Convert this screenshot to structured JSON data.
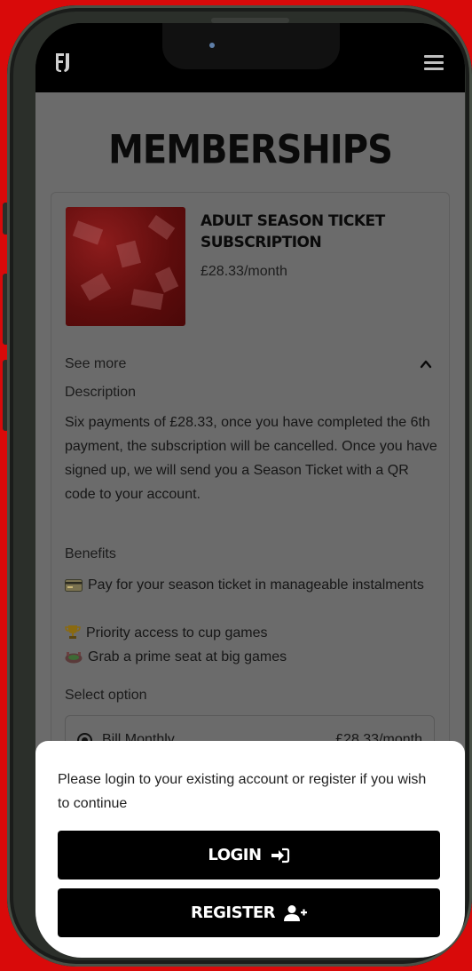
{
  "app": {
    "logo_icon": "club-crest-icon",
    "menu_icon": "hamburger-menu-icon"
  },
  "page": {
    "title": "MEMBERSHIPS"
  },
  "product": {
    "name": "ADULT SEASON TICKET SUBSCRIPTION",
    "price": "£28.33/month",
    "see_more_label": "See more",
    "description_label": "Description",
    "description": "Six payments of £28.33, once you have completed the 6th payment, the subscription will be cancelled. Once you have signed up, we will send you a Season Ticket with a QR code to your account.",
    "benefits_label": "Benefits",
    "benefits": [
      {
        "icon": "credit-card-icon",
        "text": "Pay for your season ticket in manageable instalments"
      },
      {
        "icon": "trophy-icon",
        "text": "Priority access to cup games"
      },
      {
        "icon": "stadium-icon",
        "text": "Grab a prime seat at big games"
      }
    ],
    "select_option_label": "Select option",
    "options": [
      {
        "label": "Bill Monthly",
        "price": "£28.33/month",
        "selected": true
      }
    ]
  },
  "sheet": {
    "message": "Please login to your existing account or register if you wish to continue",
    "login_label": "LOGIN",
    "register_label": "REGISTER"
  },
  "colors": {
    "background": "#d90a0a",
    "overlay_content": "#6b6b6b",
    "button": "#000000",
    "sheet": "#ffffff"
  }
}
